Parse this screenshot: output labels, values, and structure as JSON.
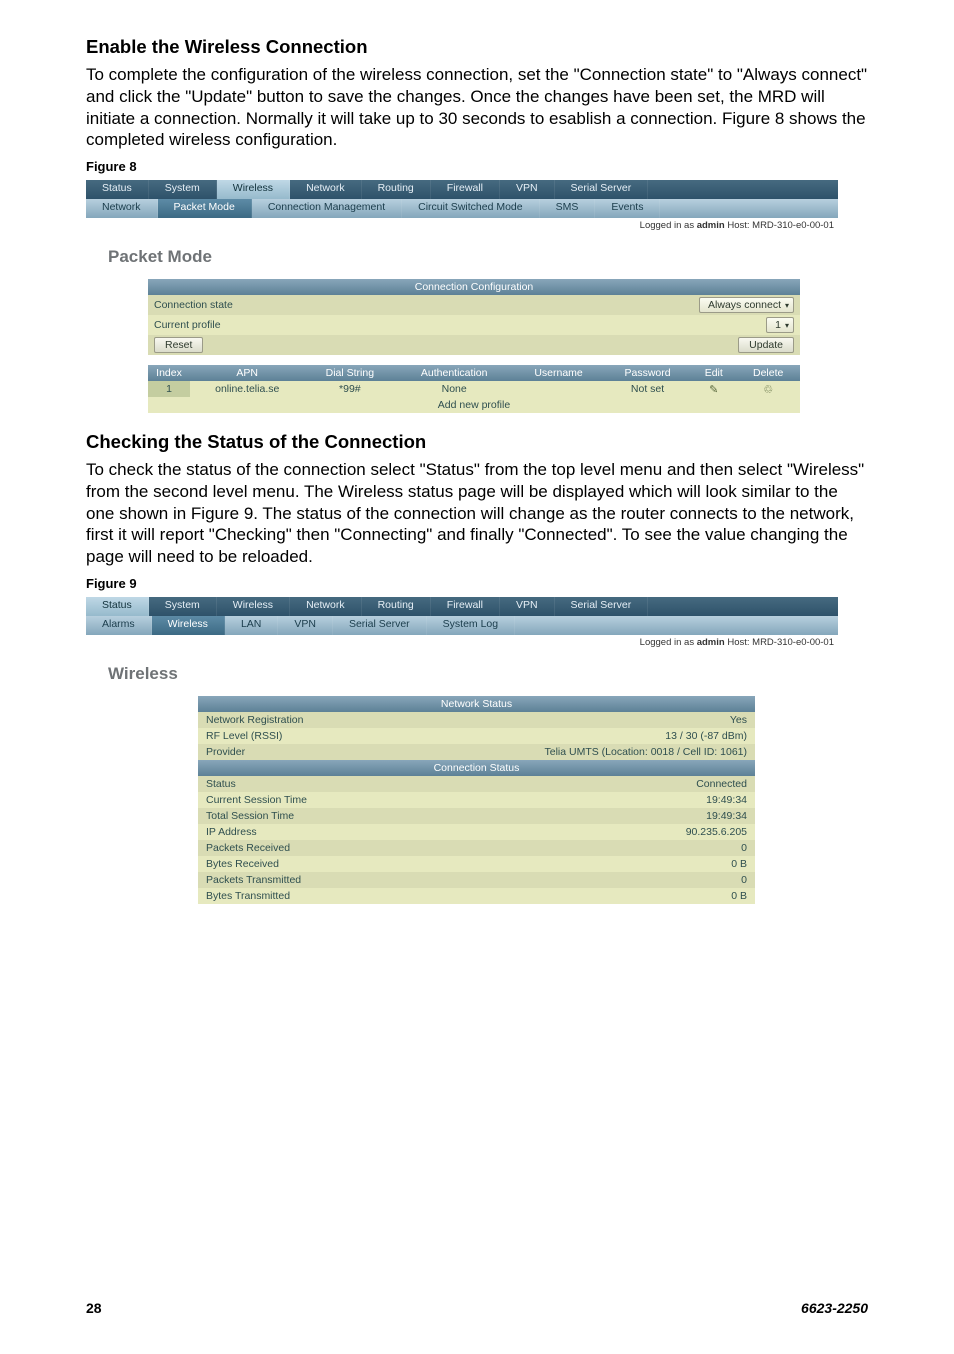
{
  "section1": {
    "heading": "Enable the Wireless Connection",
    "para": "To complete the configuration of the wireless connection, set the \"Connection state\" to \"Always connect\" and click the \"Update\" button to save the changes. Once the changes have been set, the MRD will initiate a connection. Normally it will take up to 30 seconds to esablish a connection. Figure 8 shows the completed wireless configuration.",
    "fig_label": "Figure 8"
  },
  "section2": {
    "heading": "Checking the Status of the Connection",
    "para": "To check the status of the connection select \"Status\" from the top level menu and then select \"Wireless\" from the second level menu. The Wireless status page will be displayed which will look similar to the one shown in Figure 9. The status of the connection will change as the router connects to the network, first it will report \"Checking\" then \"Connecting\" and finally \"Connected\". To see the value changing the page will need to be reloaded.",
    "fig_label": "Figure 9"
  },
  "shot1": {
    "nav1": [
      "Status",
      "System",
      "Wireless",
      "Network",
      "Routing",
      "Firewall",
      "VPN",
      "Serial Server"
    ],
    "nav1_active": 2,
    "nav2": [
      "Network",
      "Packet Mode",
      "Connection Management",
      "Circuit Switched Mode",
      "SMS",
      "Events"
    ],
    "nav2_active": 1,
    "login_prefix": "Logged in as ",
    "login_user": "admin",
    "login_suffix": " Host: MRD-310-e0-00-01",
    "page_title": "Packet Mode",
    "cc_header": "Connection Configuration",
    "rows": {
      "conn_state_label": "Connection state",
      "conn_state_value": "Always connect",
      "current_profile_label": "Current profile",
      "current_profile_value": "1",
      "reset_btn": "Reset",
      "update_btn": "Update"
    },
    "grid": {
      "headers": [
        "Index",
        "APN",
        "Dial String",
        "Authentication",
        "Username",
        "Password",
        "Edit",
        "Delete"
      ],
      "row": {
        "index": "1",
        "apn": "online.telia.se",
        "dial": "*99#",
        "auth": "None",
        "user": "",
        "pass": "Not set"
      },
      "add_btn": "Add new profile"
    }
  },
  "shot2": {
    "nav1": [
      "Status",
      "System",
      "Wireless",
      "Network",
      "Routing",
      "Firewall",
      "VPN",
      "Serial Server"
    ],
    "nav1_active": 0,
    "nav2": [
      "Alarms",
      "Wireless",
      "LAN",
      "VPN",
      "Serial Server",
      "System Log"
    ],
    "nav2_active": 1,
    "login_prefix": "Logged in as ",
    "login_user": "admin",
    "login_suffix": " Host: MRD-310-e0-00-01",
    "page_title": "Wireless",
    "net_hdr": "Network Status",
    "conn_hdr": "Connection Status",
    "rows": {
      "net_reg_label": "Network Registration",
      "net_reg_value": "Yes",
      "rf_label": "RF Level (RSSI)",
      "rf_value": "13 / 30 (-87 dBm)",
      "provider_label": "Provider",
      "provider_value": "Telia UMTS (Location: 0018 / Cell ID: 1061)",
      "status_label": "Status",
      "status_value": "Connected",
      "cur_sess_label": "Current Session Time",
      "cur_sess_value": "19:49:34",
      "tot_sess_label": "Total Session Time",
      "tot_sess_value": "19:49:34",
      "ip_label": "IP Address",
      "ip_value": "90.235.6.205",
      "prx_label": "Packets Received",
      "prx_value": "0",
      "brx_label": "Bytes Received",
      "brx_value": "0 B",
      "ptx_label": "Packets Transmitted",
      "ptx_value": "0",
      "btx_label": "Bytes Transmitted",
      "btx_value": "0 B"
    }
  },
  "footer": {
    "page": "28",
    "doc": "6623-2250"
  }
}
